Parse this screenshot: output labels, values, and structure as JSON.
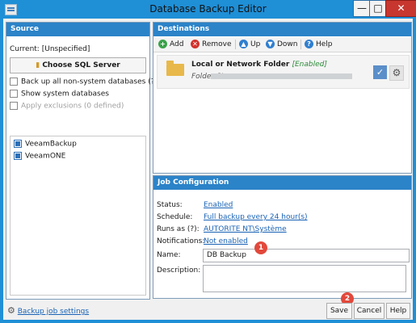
{
  "window": {
    "title": "Database Backup Editor",
    "min": "—",
    "max": "□",
    "close": "✕"
  },
  "source": {
    "title": "Source",
    "current_label": "Current:",
    "current_value": "[Unspecified]",
    "choose_button": "Choose SQL Server",
    "options": [
      {
        "label": "Back up all non-system databases (?)",
        "checked": false,
        "disabled": false
      },
      {
        "label": "Show system databases",
        "checked": false,
        "disabled": false
      },
      {
        "label": "Apply exclusions (0 defined)",
        "checked": false,
        "disabled": true
      }
    ],
    "databases": [
      {
        "name": "VeeamBackup",
        "checked": true
      },
      {
        "name": "VeeamONE",
        "checked": true
      }
    ]
  },
  "destinations": {
    "title": "Destinations",
    "toolbar": {
      "add": "Add",
      "remove": "Remove",
      "up": "Up",
      "down": "Down",
      "help": "Help"
    },
    "repository": {
      "name": "Local or Network Folder",
      "status": "[Enabled]",
      "folder_prefix": "Folder (\\\\"
    }
  },
  "job": {
    "title": "Job Configuration",
    "status_label": "Status:",
    "status_value": "Enabled",
    "schedule_label": "Schedule:",
    "schedule_value": "Full backup every 24 hour(s)",
    "runas_label": "Runs as (?):",
    "runas_value": "AUTORITE NT\\Système",
    "notifications_label": "Notifications:",
    "notifications_value": "Not enabled",
    "name_label": "Name:",
    "name_value": "DB Backup",
    "description_label": "Description:",
    "description_value": ""
  },
  "footer": {
    "settings_link": "Backup job settings",
    "save": "Save",
    "cancel": "Cancel",
    "help": "Help"
  },
  "annotations": {
    "name_badge": "1",
    "save_badge": "2"
  },
  "colors": {
    "titlebar": "#1f8fd6",
    "panel_header": "#2b83c8",
    "link": "#1a63b5",
    "close": "#c7372f",
    "badge": "#e2483b"
  }
}
